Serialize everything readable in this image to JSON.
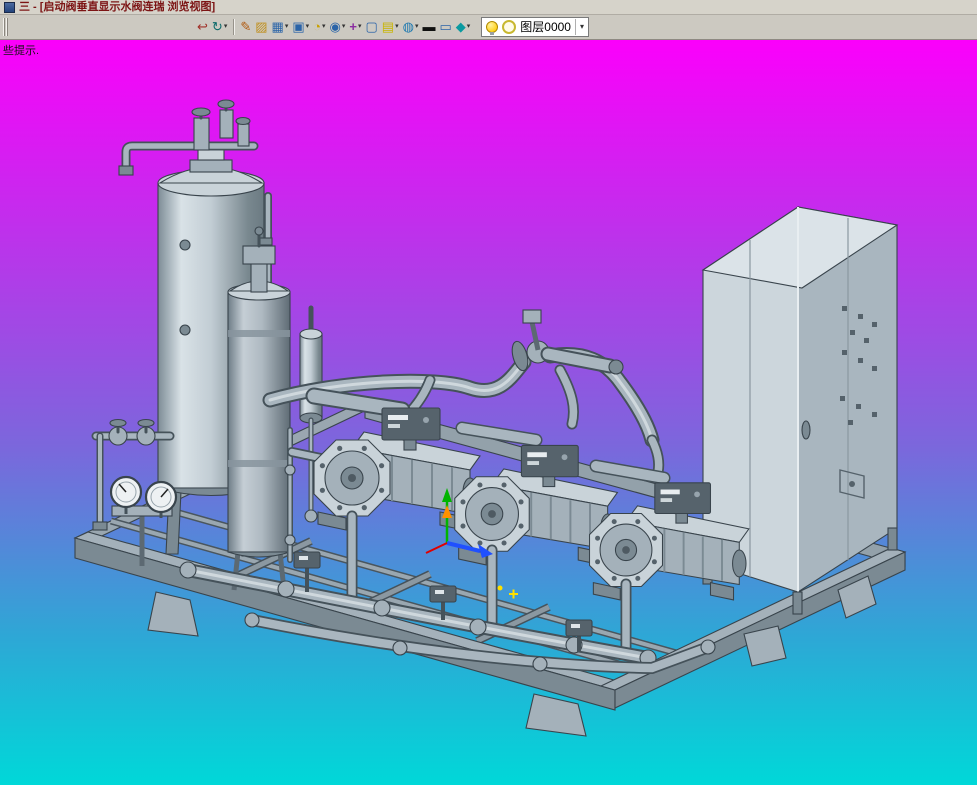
{
  "window": {
    "title": "三 - [启动阀垂直显示水阀连瑞 浏览视图]"
  },
  "hint": "些提示.",
  "toolbar": {
    "layer_label": "图层0000",
    "dropdown_glyph": "▾",
    "icons": [
      {
        "name": "exit-render-icon",
        "glyph": "↩",
        "fg": "#a03028",
        "dropdown": false
      },
      {
        "name": "orbit-view-icon",
        "glyph": "↻",
        "fg": "#0a6a6a",
        "dropdown": true
      },
      {
        "separator": true
      },
      {
        "name": "sketch-pencil-icon",
        "glyph": "✎",
        "fg": "#b05a10",
        "dropdown": false
      },
      {
        "name": "palette-icon",
        "glyph": "▨",
        "fg": "#c09020",
        "dropdown": false
      },
      {
        "name": "solid-cube-icon",
        "glyph": "▦",
        "fg": "#2b64a8",
        "dropdown": true
      },
      {
        "name": "view-window-icon",
        "glyph": "▣",
        "fg": "#2b64a8",
        "dropdown": true
      },
      {
        "name": "render-pie-icon",
        "glyph": "◔",
        "fg": "#c8a000",
        "dropdown": true
      },
      {
        "name": "zoom-icon",
        "glyph": "◉",
        "fg": "#2b64a8",
        "dropdown": true
      },
      {
        "name": "move-axes-icon",
        "glyph": "+",
        "fg": "#8a2ca0",
        "bold": true,
        "dropdown": true
      },
      {
        "name": "frame-icon",
        "glyph": "▢",
        "fg": "#2b64a8",
        "dropdown": false
      },
      {
        "name": "sheet-icon",
        "glyph": "▤",
        "fg": "#c8b400",
        "dropdown": true
      },
      {
        "name": "image-icon",
        "glyph": "◍",
        "fg": "#1c78b0",
        "dropdown": true
      },
      {
        "name": "line-width-icon",
        "glyph": "▬",
        "fg": "#101010",
        "dropdown": false
      },
      {
        "name": "canvas-icon",
        "glyph": "▭",
        "fg": "#2b64a8",
        "dropdown": false
      },
      {
        "name": "material-icon",
        "glyph": "◆",
        "fg": "#0a9aa0",
        "dropdown": true
      }
    ]
  },
  "viewport": {
    "colors": {
      "top": "#fb00fb",
      "upper": "#b935ea",
      "mid": "#7a68dc",
      "lower": "#2ea7d6",
      "bottom": "#00d8d8",
      "steel_light": "#c9d3d9",
      "steel_dark": "#7b8a93",
      "axis_green": "#00b400",
      "axis_blue": "#2050ff",
      "axis_red": "#e00000"
    }
  }
}
